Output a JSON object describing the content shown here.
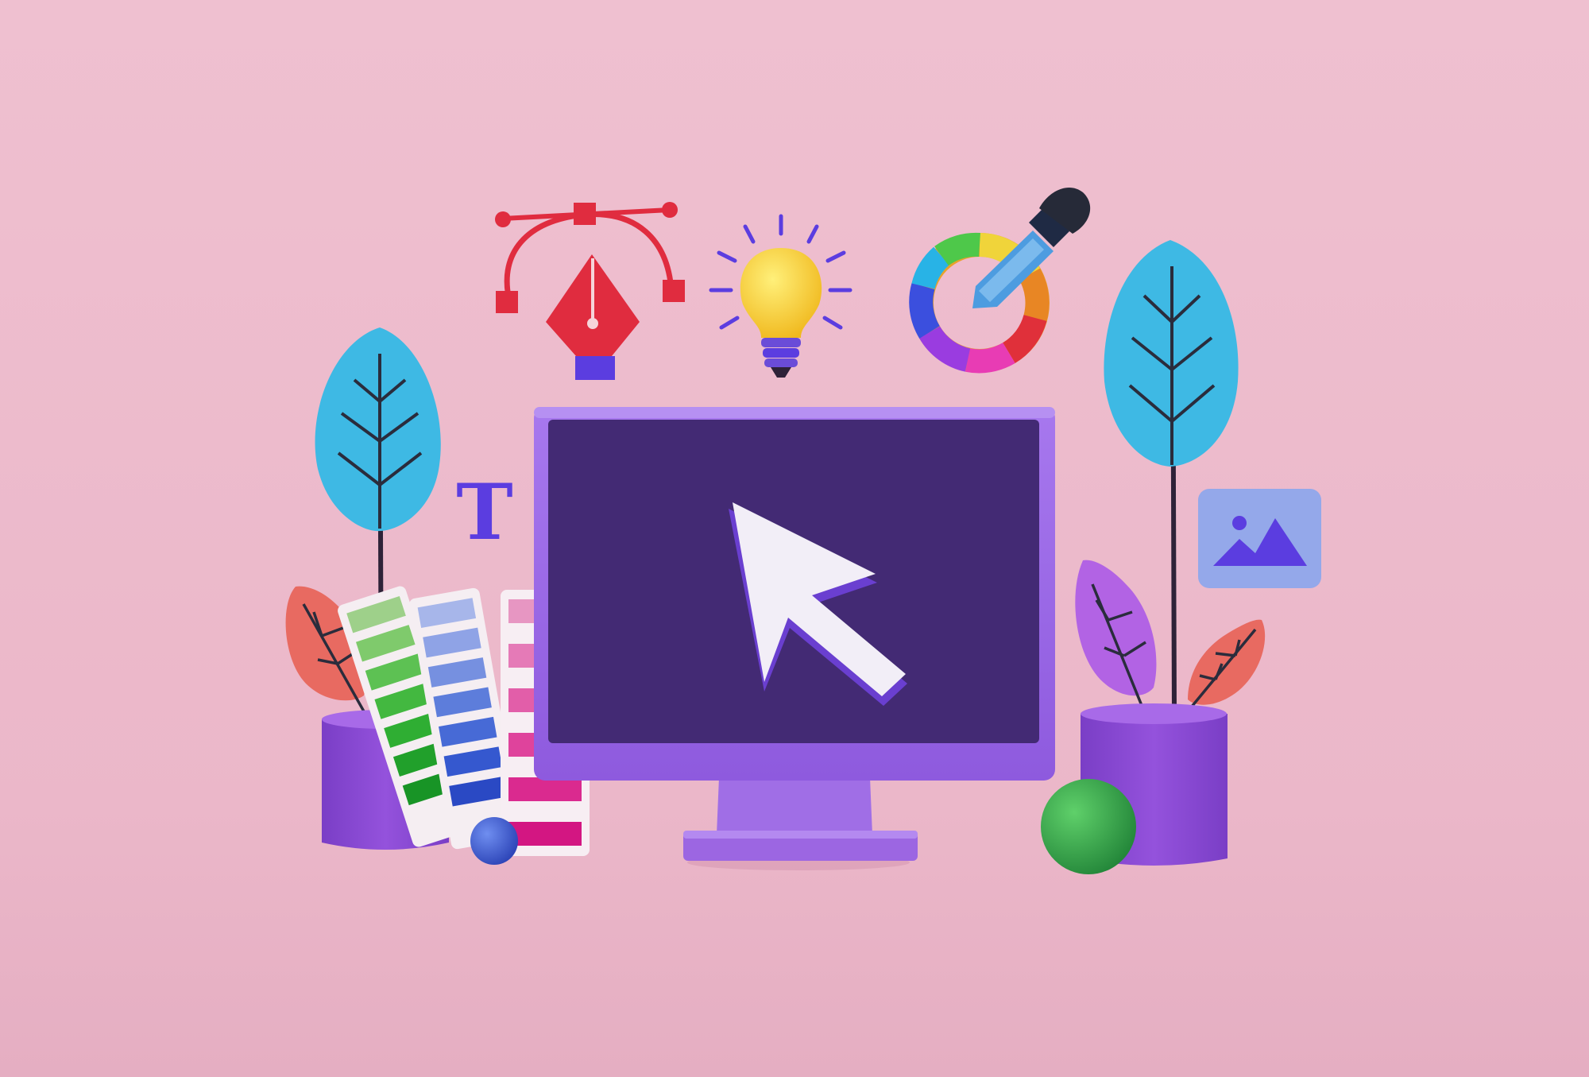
{
  "palette": {
    "background": "#edbccc",
    "floor": "#e7b1c3",
    "monitor_frame": "#9d6be6",
    "monitor_screen": "#432a74",
    "cursor": "#f2eef7",
    "pen_tool": "#e02c3f",
    "bulb": "#f5cf2e",
    "bulb_base": "#6a4cd8",
    "eyedropper": "#4d9ce0",
    "leaf_blue": "#3eb9e4",
    "leaf_coral": "#e86a61",
    "leaf_purple": "#b263e4",
    "pot": "#8b4bd4",
    "ball_blue": "#3c5ee0",
    "ball_green": "#3aa84a",
    "image_card": "#94a8ea",
    "type_icon": "#5b3de0"
  },
  "icons": [
    "pen-tool-icon",
    "light-bulb-icon",
    "color-wheel-icon",
    "eyedropper-icon",
    "text-tool-icon",
    "image-icon",
    "cursor-arrow-icon"
  ],
  "text_tool_letter": "T"
}
